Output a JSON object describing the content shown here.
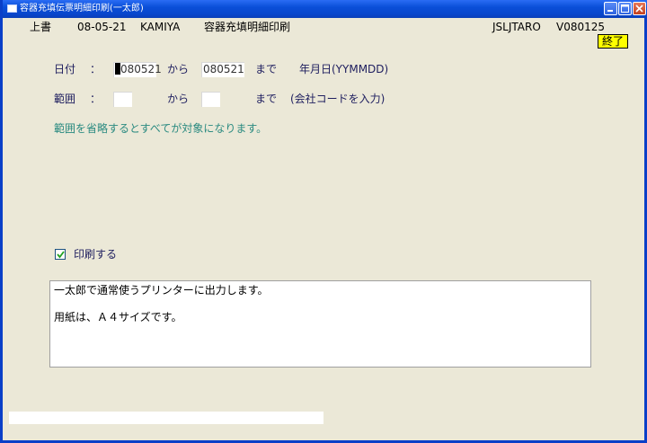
{
  "window": {
    "title": "容器充填伝票明細印刷(一太郎)"
  },
  "header": {
    "mode": "上書",
    "date": "08-05-21",
    "user": "KAMIYA",
    "screen_title": "容器充填明細印刷",
    "program_id": "JSLJTARO",
    "version": "V080125",
    "exit_label": "終了"
  },
  "form": {
    "date_label": "日付",
    "colon": "：",
    "date_from": "080521",
    "from_label": "から",
    "date_to": "080521",
    "to_label": "まで",
    "date_hint": "年月日(YYMMDD)",
    "range_label": "範囲",
    "range_from": "",
    "range_to": "",
    "range_hint": "(会社コードを入力)",
    "note": "範囲を省略するとすべてが対象になります。",
    "print_checkbox_label": "印刷する",
    "print_checked": true
  },
  "message": {
    "line1": "一太郎で通常使うプリンターに出力します。",
    "line2": "用紙は、Ａ４サイズです。"
  },
  "status": {
    "text": ""
  },
  "colors": {
    "exit_bg": "#FFFF00",
    "note_color": "#2A8A80",
    "titlebar": "#0A4FD8"
  }
}
